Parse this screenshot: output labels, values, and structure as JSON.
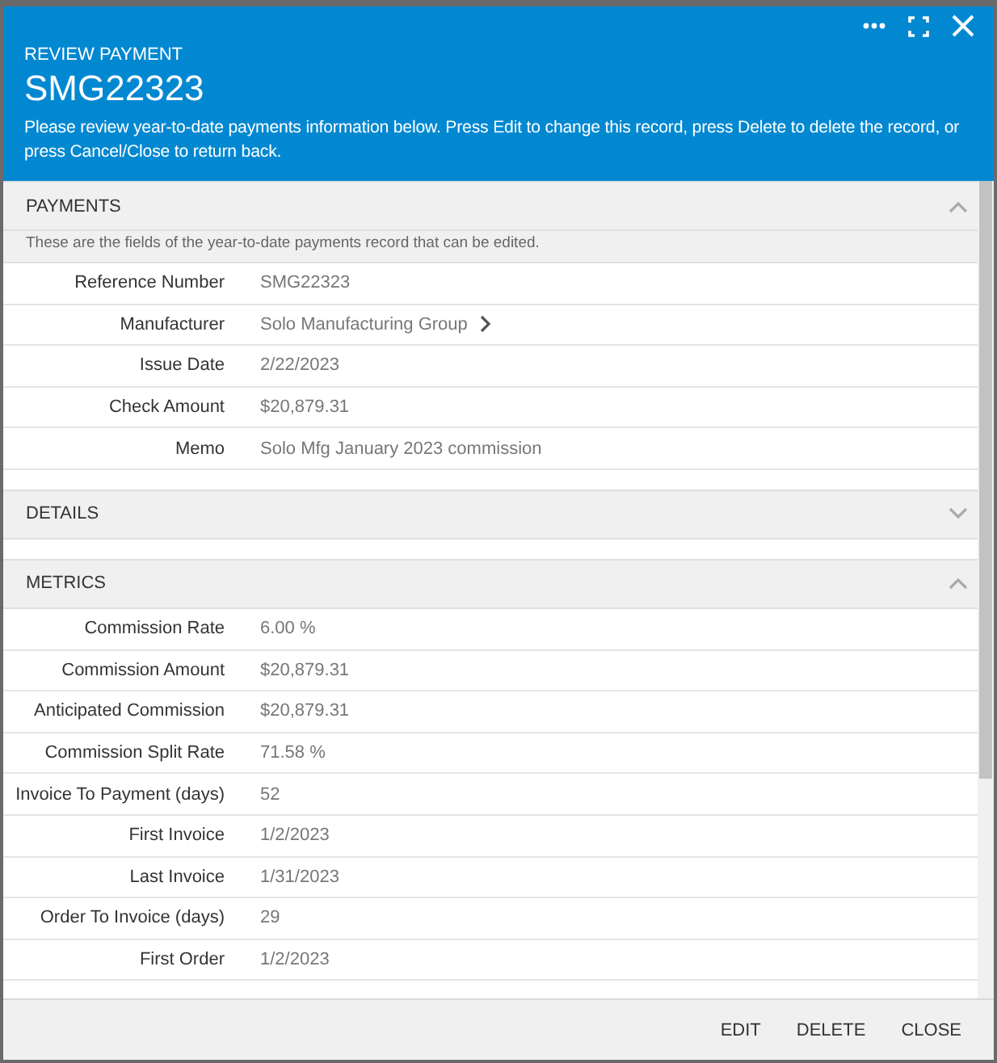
{
  "header": {
    "eyebrow": "REVIEW PAYMENT",
    "title": "SMG22323",
    "message": "Please review year-to-date payments information below. Press Edit to change this record, press Delete to delete the record, or press Cancel/Close to return back."
  },
  "sections": [
    {
      "title": "PAYMENTS",
      "expanded": true,
      "description": "These are the fields of the year-to-date payments record that can be edited.",
      "fields": [
        {
          "label": "Reference Number",
          "value": "SMG22323",
          "link": false
        },
        {
          "label": "Manufacturer",
          "value": "Solo Manufacturing Group",
          "link": true
        },
        {
          "label": "Issue Date",
          "value": "2/22/2023",
          "link": false
        },
        {
          "label": "Check Amount",
          "value": "$20,879.31",
          "link": false
        },
        {
          "label": "Memo",
          "value": "Solo Mfg January 2023 commission",
          "link": false
        }
      ]
    },
    {
      "title": "DETAILS",
      "expanded": false
    },
    {
      "title": "METRICS",
      "expanded": true,
      "fields": [
        {
          "label": "Commission Rate",
          "value": "6.00 %",
          "link": false
        },
        {
          "label": "Commission Amount",
          "value": "$20,879.31",
          "link": false
        },
        {
          "label": "Anticipated Commission",
          "value": "$20,879.31",
          "link": false
        },
        {
          "label": "Commission Split Rate",
          "value": "71.58 %",
          "link": false
        },
        {
          "label": "Invoice To Payment (days)",
          "value": "52",
          "link": false
        },
        {
          "label": "First Invoice",
          "value": "1/2/2023",
          "link": false
        },
        {
          "label": "Last Invoice",
          "value": "1/31/2023",
          "link": false
        },
        {
          "label": "Order To Invoice (days)",
          "value": "29",
          "link": false
        },
        {
          "label": "First Order",
          "value": "1/2/2023",
          "link": false
        }
      ]
    }
  ],
  "buttons": [
    "EDIT",
    "DELETE",
    "CLOSE"
  ]
}
